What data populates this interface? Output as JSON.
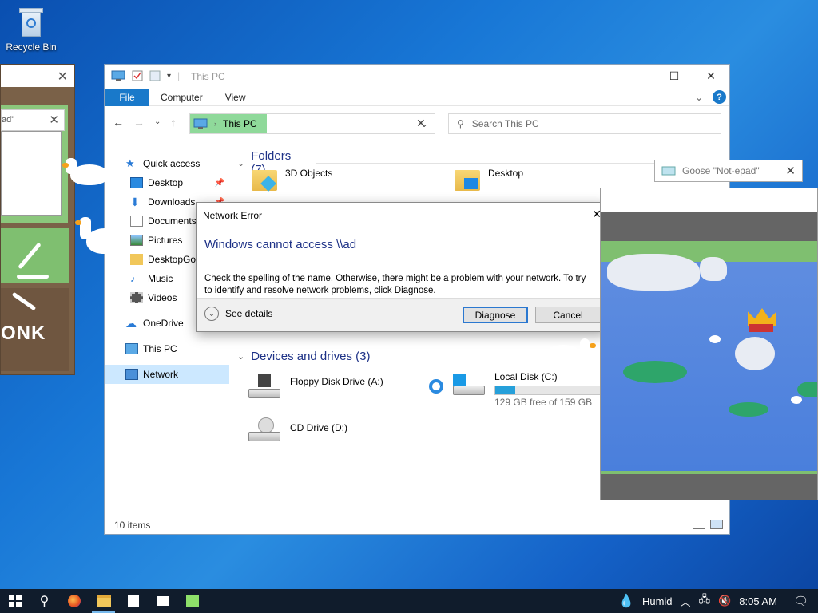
{
  "desktop": {
    "recycle_bin_label": "Recycle Bin"
  },
  "note_window": {
    "text_fragment": "ad\"",
    "honk_text": "ONK"
  },
  "explorer": {
    "title": "This PC",
    "ribbon": {
      "file": "File",
      "tabs": [
        "Computer",
        "View"
      ]
    },
    "address": "This PC",
    "search_placeholder": "Search This PC",
    "sidebar": [
      {
        "label": "Quick access",
        "icon": "star-icon"
      },
      {
        "label": "Desktop",
        "icon": "desktop-icon",
        "pinned": true
      },
      {
        "label": "Downloads",
        "icon": "download-icon",
        "pinned": true
      },
      {
        "label": "Documents",
        "icon": "document-icon"
      },
      {
        "label": "Pictures",
        "icon": "pictures-icon"
      },
      {
        "label": "DesktopGoo",
        "icon": "folder-icon"
      },
      {
        "label": "Music",
        "icon": "music-icon"
      },
      {
        "label": "Videos",
        "icon": "video-icon"
      },
      {
        "label": "OneDrive",
        "icon": "cloud-icon"
      },
      {
        "label": "This PC",
        "icon": "computer-icon"
      },
      {
        "label": "Network",
        "icon": "network-icon",
        "selected": true
      }
    ],
    "folders_header": "Folders (7)",
    "folders": [
      {
        "name": "3D Objects"
      },
      {
        "name": "Desktop"
      }
    ],
    "devices_header": "Devices and drives (3)",
    "drives": [
      {
        "name": "Floppy Disk Drive (A:)"
      },
      {
        "name": "Local Disk (C:)",
        "free_text": "129 GB free of 159 GB",
        "used_fraction": 0.19
      },
      {
        "name": "CD Drive (D:)"
      }
    ],
    "status": "10 items"
  },
  "dialog": {
    "title": "Network Error",
    "heading": "Windows cannot access \\\\ad",
    "body_line1": "Check the spelling of the name. Otherwise, there might be a problem with your network. To try",
    "body_line2": "to identify and resolve network problems, click Diagnose.",
    "see_details": "See details",
    "diagnose": "Diagnose",
    "cancel": "Cancel"
  },
  "goose_window": {
    "title": "Goose \"Not-epad\""
  },
  "taskbar": {
    "weather": "Humid",
    "time": "8:05 AM"
  },
  "colors": {
    "accent": "#1979ca",
    "taskbar": "#101c2c",
    "highlight": "#8fd99a",
    "link_blue": "#1e3287"
  }
}
